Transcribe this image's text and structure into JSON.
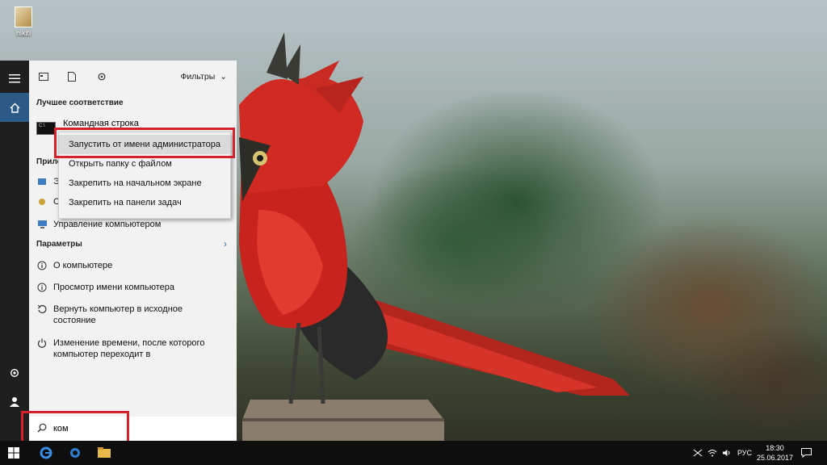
{
  "desktop": {
    "icon_label": "nikiti"
  },
  "search_panel": {
    "filters_label": "Фильтры",
    "best_match_header": "Лучшее соответствие",
    "best_match_item": "Командная строка",
    "apps_header": "Прило",
    "app_items": [
      "Эт",
      "С"
    ],
    "computer_management": "Управление компьютером",
    "settings_header": "Параметры",
    "settings_items": [
      "О компьютере",
      "Просмотр имени компьютера",
      "Вернуть компьютер в исходное состояние",
      "Изменение времени, после которого компьютер переходит в"
    ]
  },
  "context_menu": {
    "items": [
      "Запустить от имени администратора",
      "Открыть папку с файлом",
      "Закрепить на начальном экране",
      "Закрепить на панели задач"
    ]
  },
  "search": {
    "value": "ком"
  },
  "taskbar": {
    "language": "РУС",
    "time": "18:30",
    "date": "25.06.2017"
  },
  "colors": {
    "highlight": "#d6202a",
    "accent": "#2b5a87"
  }
}
